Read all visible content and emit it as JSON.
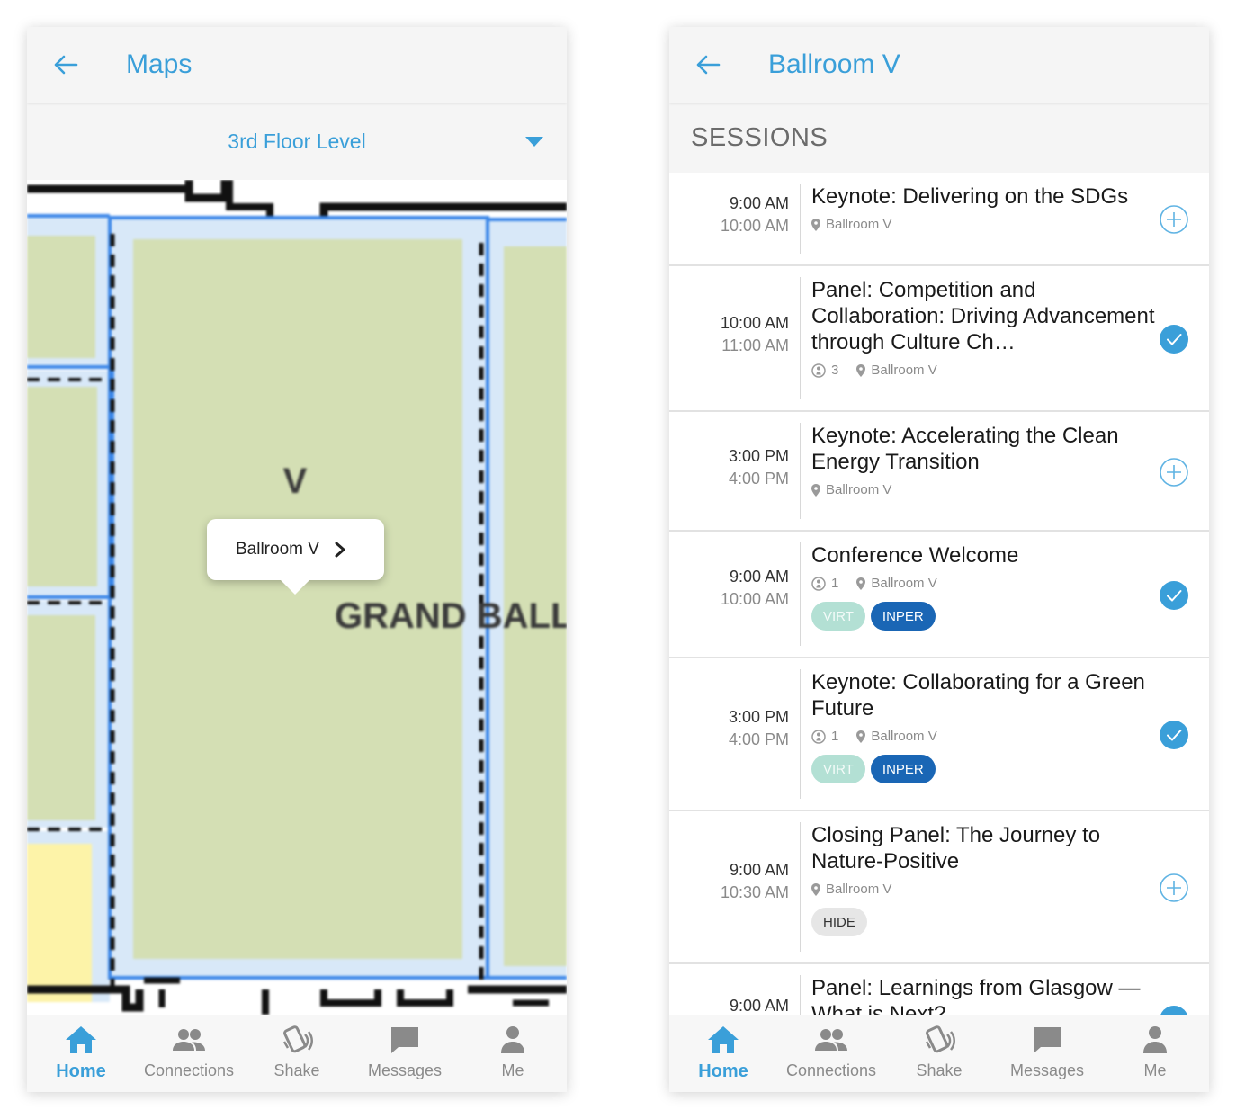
{
  "colors": {
    "accent": "#3a9fd9",
    "inperson": "#1a66b5",
    "virtual": "#b3e0d4",
    "room_fill": "#d4dfb4",
    "room_border": "#3a86e8"
  },
  "map_screen": {
    "title": "Maps",
    "floor_selector": "3rd Floor Level",
    "map_labels": {
      "room_letter": "V",
      "hall_name": "GRAND BALLRO"
    },
    "popup_label": "Ballroom V"
  },
  "sessions_screen": {
    "title": "Ballroom V",
    "section_title": "SESSIONS",
    "sessions": [
      {
        "start": "9:00 AM",
        "end": "10:00 AM",
        "title": "Keynote: Delivering on the SDGs",
        "location": "Ballroom V",
        "count": "",
        "tags": [],
        "action": "plus-circle-icon"
      },
      {
        "start": "10:00 AM",
        "end": "11:00 AM",
        "title": "Panel: Competition and Collaboration: Driving Advancement through Culture Ch…",
        "location": "Ballroom V",
        "count": "3",
        "tags": [],
        "action": "check-circle-icon"
      },
      {
        "start": "3:00 PM",
        "end": "4:00 PM",
        "title": "Keynote: Accelerating the Clean Energy Transition",
        "location": "Ballroom V",
        "count": "",
        "tags": [],
        "action": "plus-circle-icon"
      },
      {
        "start": "9:00 AM",
        "end": "10:00 AM",
        "title": "Conference Welcome",
        "location": "Ballroom V",
        "count": "1",
        "tags": [
          "VIRT",
          "INPER"
        ],
        "action": "check-circle-icon"
      },
      {
        "start": "3:00 PM",
        "end": "4:00 PM",
        "title": "Keynote: Collaborating for a Green Future",
        "location": "Ballroom V",
        "count": "1",
        "tags": [
          "VIRT",
          "INPER"
        ],
        "action": "check-circle-icon"
      },
      {
        "start": "9:00 AM",
        "end": "10:30 AM",
        "title": "Closing Panel: The Journey to Nature-Positive",
        "location": "Ballroom V",
        "count": "",
        "tags": [
          "HIDE"
        ],
        "action": "plus-circle-icon"
      },
      {
        "start": "9:00 AM",
        "end": "",
        "title": "Panel: Learnings from Glasgow — What is Next?",
        "location": "",
        "count": "",
        "tags": [],
        "action": "check-circle-icon"
      }
    ]
  },
  "nav": {
    "items": [
      {
        "label": "Home",
        "icon": "home-icon",
        "active": true
      },
      {
        "label": "Connections",
        "icon": "people-icon",
        "active": false
      },
      {
        "label": "Shake",
        "icon": "shake-icon",
        "active": false
      },
      {
        "label": "Messages",
        "icon": "message-icon",
        "active": false
      },
      {
        "label": "Me",
        "icon": "person-icon",
        "active": false
      }
    ]
  }
}
